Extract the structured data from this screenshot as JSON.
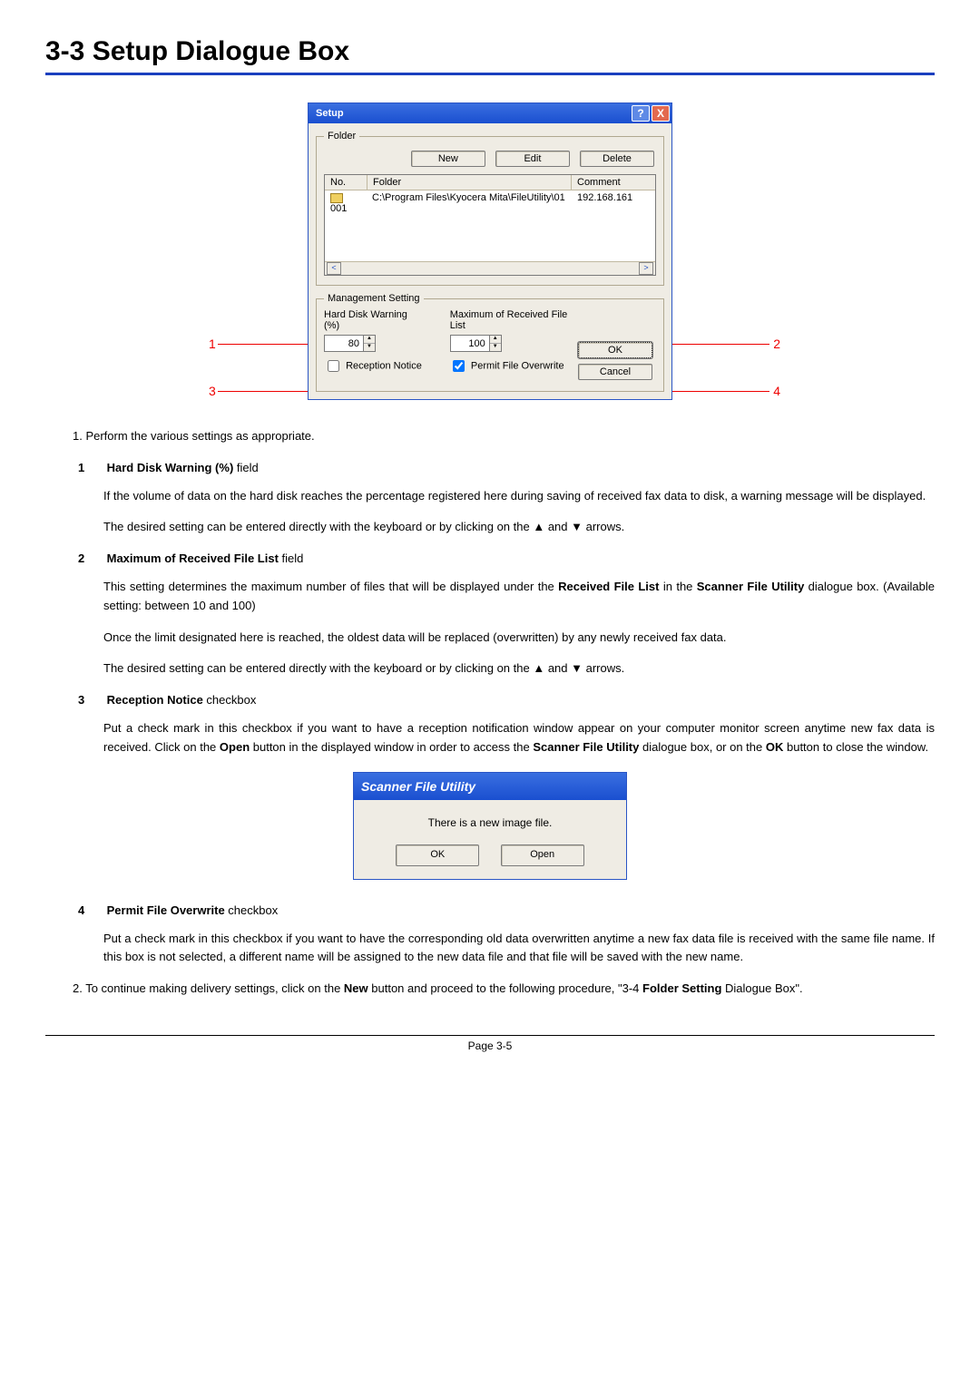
{
  "heading": "3-3  Setup Dialogue Box",
  "pageLabel": "Page 3-5",
  "annotations": {
    "a1": "1",
    "a2": "2",
    "a3": "3",
    "a4": "4"
  },
  "setupDialog": {
    "title": "Setup",
    "helpGlyph": "?",
    "closeGlyph": "X",
    "folderGroup": {
      "legend": "Folder",
      "buttons": {
        "new": "New",
        "edit": "Edit",
        "delete": "Delete"
      },
      "columns": {
        "no": "No.",
        "folder": "Folder",
        "comment": "Comment"
      },
      "row": {
        "no": "001",
        "folder": "C:\\Program Files\\Kyocera Mita\\FileUtility\\01",
        "comment": "192.168.161"
      },
      "scrollLeft": "<",
      "scrollRight": ">"
    },
    "mgmtGroup": {
      "legend": "Management Setting",
      "hdWarnLabel": "Hard Disk Warning (%)",
      "hdWarnValue": "80",
      "maxListLabel": "Maximum of Received File List",
      "maxListValue": "100",
      "receptionNotice": "Reception Notice",
      "permitOverwrite": "Permit File Overwrite",
      "ok": "OK",
      "cancel": "Cancel",
      "spinUp": "▲",
      "spinDn": "▼"
    }
  },
  "body": {
    "step1": "1. Perform the various settings as appropriate.",
    "item1": {
      "num": "1",
      "titleBold": "Hard Disk Warning (%)",
      "titleRest": " field",
      "p1": "If the volume of data on the hard disk reaches the percentage registered here during saving of received fax data to disk, a warning message will be displayed.",
      "p2a": "The desired setting can be entered directly with the keyboard or by clicking on the ",
      "p2b": " and ",
      "p2c": " arrows."
    },
    "item2": {
      "num": "2",
      "titleBold": "Maximum of Received File List",
      "titleRest": " field",
      "p1a": "This setting determines the maximum number of files that will be displayed under the ",
      "p1bold": "Received File List",
      "p1b": " in the ",
      "p1bold2": "Scanner File Utility",
      "p1c": " dialogue box. (Available setting: between 10 and 100)",
      "p2": "Once the limit designated here is reached, the oldest data will be replaced (overwritten) by any newly received fax data.",
      "p3a": "The desired setting can be entered directly with the keyboard or by clicking on the ",
      "p3b": " and ",
      "p3c": " arrows."
    },
    "item3": {
      "num": "3",
      "titleBold": "Reception Notice",
      "titleRest": " checkbox",
      "p1a": "Put a check mark in this checkbox if you want to have a reception notification window appear on your computer monitor screen anytime new fax data is received. Click on the ",
      "p1bold1": "Open",
      "p1b": " button in the displayed window in order to access the ",
      "p1bold2": "Scanner File Utility",
      "p1c": " dialogue box, or on the ",
      "p1bold3": "OK",
      "p1d": " button to close the window."
    },
    "sfu": {
      "title": "Scanner File Utility",
      "message": "There is a new image file.",
      "ok": "OK",
      "open": "Open"
    },
    "item4": {
      "num": "4",
      "titleBold": "Permit File Overwrite",
      "titleRest": " checkbox",
      "p1": "Put a check mark in this checkbox if you want to have the corresponding old data overwritten anytime a new fax data file is received with the same file name. If this box is not selected, a different name will be assigned to the new data file and that file will be saved with the new name."
    },
    "step2a": "2. To continue making delivery settings, click on the ",
    "step2bold1": "New",
    "step2b": " button and proceed to the following procedure, \"3-4 ",
    "step2bold2": "Folder Setting",
    "step2c": " Dialogue Box\"."
  }
}
